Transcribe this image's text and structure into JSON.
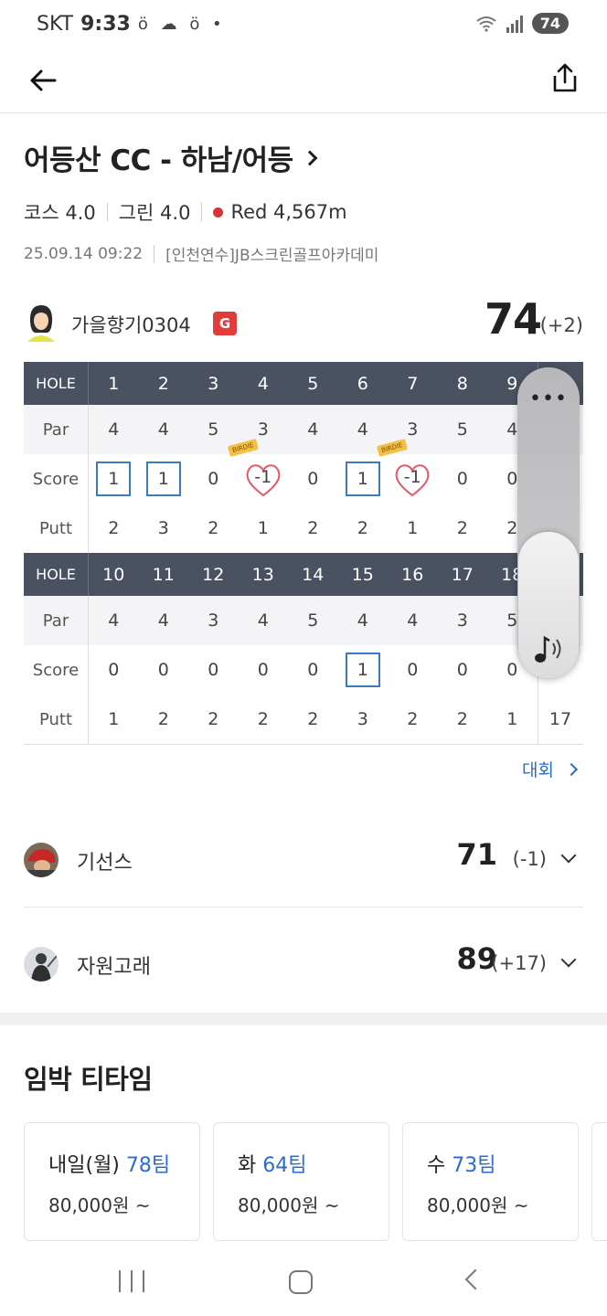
{
  "status_bar": {
    "carrier": "SKT",
    "time": "9:33",
    "notification_icons": "ö ☁ ö •",
    "battery": "74"
  },
  "course": {
    "title": "어등산 CC - 하남/어등",
    "course_rating_label": "코스 4.0",
    "green_rating_label": "그린 4.0",
    "tee_label": "Red 4,567m",
    "datetime": "25.09.14 09:22",
    "venue": "[인천연수]JB스크린골프아카데미"
  },
  "player": {
    "name": "가을향기0304",
    "badge": "G",
    "score": "74",
    "diff": "(+2)"
  },
  "scorecard": {
    "row_labels": {
      "hole": "HOLE",
      "par": "Par",
      "score": "Score",
      "putt": "Putt"
    },
    "front": {
      "holes": [
        "1",
        "2",
        "3",
        "4",
        "5",
        "6",
        "7",
        "8",
        "9"
      ],
      "par": [
        "4",
        "4",
        "5",
        "3",
        "4",
        "4",
        "3",
        "5",
        "4"
      ],
      "score": [
        "1",
        "1",
        "0",
        "-1",
        "0",
        "1",
        "-1",
        "0",
        "0"
      ],
      "putt": [
        "2",
        "3",
        "2",
        "1",
        "2",
        "2",
        "1",
        "2",
        "2"
      ],
      "total_hole": "",
      "total_par": "",
      "total_score": "",
      "total_putt": ""
    },
    "back": {
      "holes": [
        "10",
        "11",
        "12",
        "13",
        "14",
        "15",
        "16",
        "17",
        "18"
      ],
      "par": [
        "4",
        "4",
        "3",
        "4",
        "5",
        "4",
        "4",
        "3",
        "5"
      ],
      "score": [
        "0",
        "0",
        "0",
        "0",
        "0",
        "1",
        "0",
        "0",
        "0"
      ],
      "putt": [
        "1",
        "2",
        "2",
        "2",
        "2",
        "3",
        "2",
        "2",
        "1"
      ],
      "total_hole": "",
      "total_par": "",
      "total_score": "",
      "total_putt": "17"
    },
    "birdie_tag": "BIRDIE"
  },
  "tournament_link": "대회",
  "others": [
    {
      "name": "기선스",
      "score": "71",
      "diff": "(-1)"
    },
    {
      "name": "자원고래",
      "score": "89",
      "diff": "(+17)"
    }
  ],
  "tee_times": {
    "title": "임박 티타임",
    "cards": [
      {
        "day": "내일(월)",
        "teams": "78팀",
        "price": "80,000원 ~"
      },
      {
        "day": "화",
        "teams": "64팀",
        "price": "80,000원 ~"
      },
      {
        "day": "수",
        "teams": "73팀",
        "price": "80,000원 ~"
      }
    ]
  },
  "colors": {
    "header_bg": "#4a5261",
    "accent_blue": "#2a6dcc",
    "red_dot": "#e03131",
    "badge_red": "#e03c3c"
  }
}
